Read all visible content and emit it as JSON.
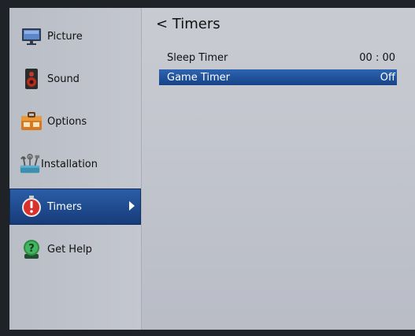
{
  "sidebar": {
    "items": [
      {
        "label": "Picture",
        "icon": "monitor-icon"
      },
      {
        "label": "Sound",
        "icon": "speaker-icon"
      },
      {
        "label": "Options",
        "icon": "toolbox-icon"
      },
      {
        "label": "Installation",
        "icon": "tools-icon"
      },
      {
        "label": "Timers",
        "icon": "stopwatch-icon",
        "selected": true
      },
      {
        "label": "Get Help",
        "icon": "help-icon"
      }
    ]
  },
  "main": {
    "title": "Timers",
    "back_glyph": "<",
    "rows": [
      {
        "label": "Sleep Timer",
        "value": "00 : 00"
      },
      {
        "label": "Game Timer",
        "value": "Off",
        "selected": true
      }
    ]
  },
  "colors": {
    "selection_blue": "#1f4f95",
    "panel_bg": "#c4c7cf"
  }
}
